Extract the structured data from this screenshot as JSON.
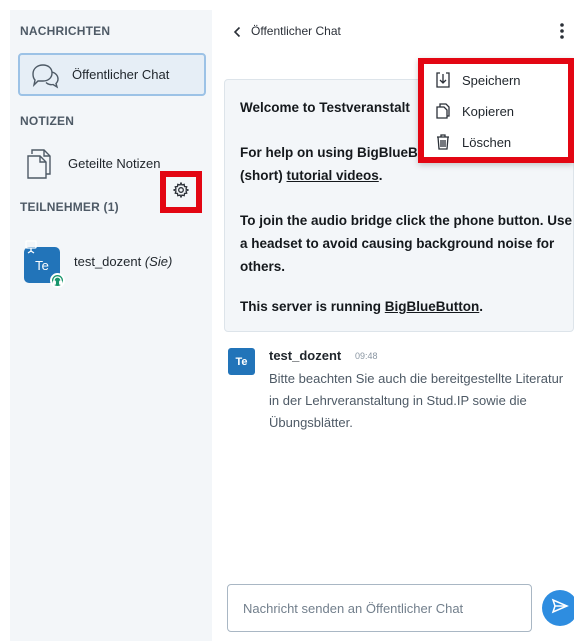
{
  "sidebar": {
    "messages_title": "NACHRICHTEN",
    "public_chat_label": "Öffentlicher Chat",
    "notes_title": "NOTIZEN",
    "shared_notes_label": "Geteilte Notizen",
    "participants_title": "TEILNEHMER (1)",
    "user": {
      "avatar_initials": "Te",
      "name": "test_dozent",
      "suffix": "(Sie)"
    }
  },
  "header": {
    "title": "Öffentlicher Chat"
  },
  "welcome": {
    "line1_prefix": "Welcome to ",
    "line1_bold": "Testveranstalt",
    "line2_prefix": "For help on using BigBlueB",
    "line3_prefix": "(short) ",
    "line3_link": "tutorial videos",
    "line3_suffix": ".",
    "line4": "To join the audio bridge click the phone button. Use a headset to avoid causing background noise for others.",
    "line5_prefix": "This server is running ",
    "line5_link": "BigBlueButton",
    "line5_suffix": "."
  },
  "message": {
    "avatar": "Te",
    "author": "test_dozent",
    "time": "09:48",
    "text": "Bitte beachten Sie auch die bereitgestellte Literatur in der Lehrveranstaltung in Stud.IP sowie die Übungsblätter."
  },
  "input": {
    "placeholder": "Nachricht senden an Öffentlicher Chat"
  },
  "menu": {
    "items": [
      {
        "label": "Speichern",
        "icon": "download-icon"
      },
      {
        "label": "Kopieren",
        "icon": "copy-icon"
      },
      {
        "label": "Löschen",
        "icon": "trash-icon"
      }
    ]
  },
  "colors": {
    "accent": "#2274b9",
    "highlight": "#e30613",
    "send": "#2e8de0"
  }
}
